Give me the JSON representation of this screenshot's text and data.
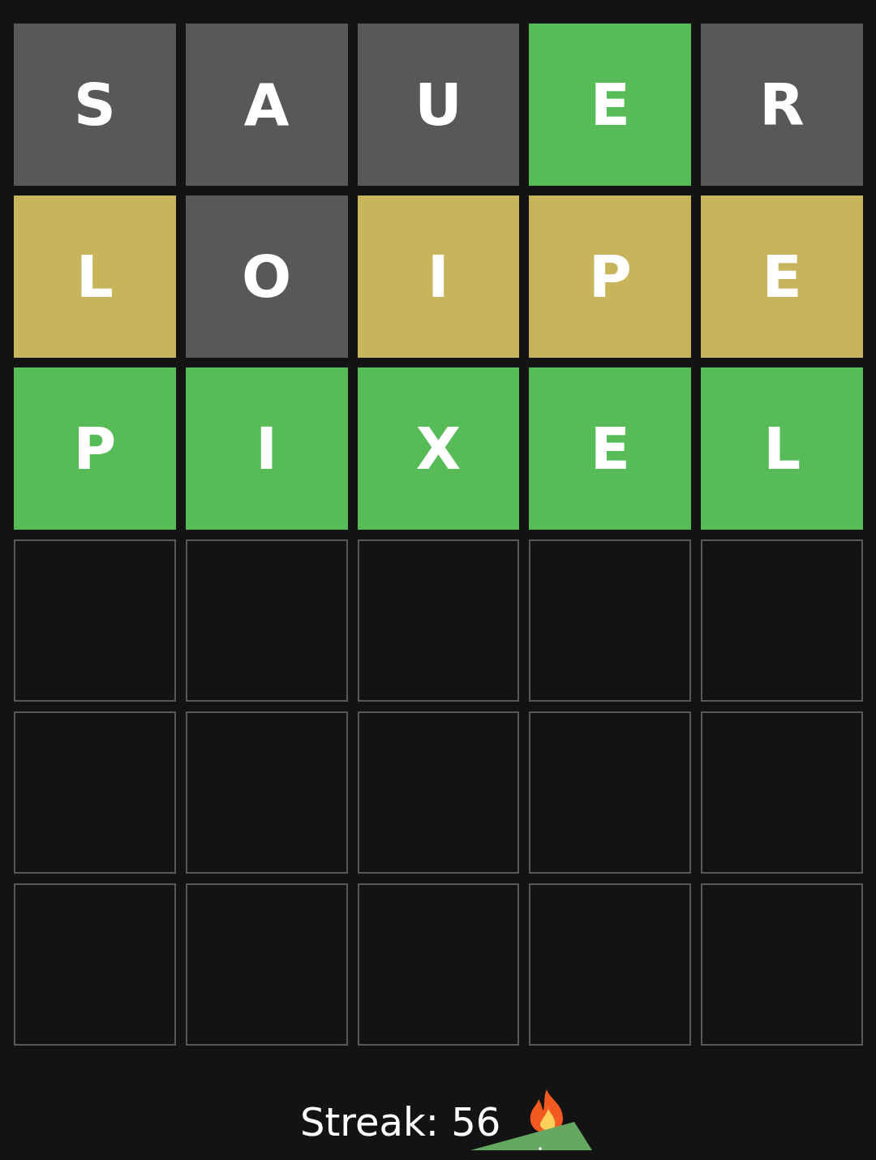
{
  "board": [
    {
      "tiles": [
        {
          "kind": "letter",
          "letter": "S",
          "color": "#585858"
        },
        {
          "kind": "letter",
          "letter": "A",
          "color": "#585858"
        },
        {
          "kind": "letter",
          "letter": "U",
          "color": "#585858"
        },
        {
          "kind": "letter",
          "letter": "E",
          "color": "#57bb58"
        },
        {
          "kind": "letter",
          "letter": "R",
          "color": "#585858"
        }
      ]
    },
    {
      "tiles": [
        {
          "kind": "letter",
          "letter": "L",
          "color": "#c8b45a"
        },
        {
          "kind": "letter",
          "letter": "O",
          "color": "#585858"
        },
        {
          "kind": "letter",
          "letter": "I",
          "color": "#c8b45a"
        },
        {
          "kind": "letter",
          "letter": "P",
          "color": "#c8b45a"
        },
        {
          "kind": "letter",
          "letter": "E",
          "color": "#c8b45a"
        }
      ]
    },
    {
      "tiles": [
        {
          "kind": "letter",
          "letter": "P",
          "color": "#57bb58"
        },
        {
          "kind": "letter",
          "letter": "I",
          "color": "#57bb58"
        },
        {
          "kind": "letter",
          "letter": "X",
          "color": "#57bb58"
        },
        {
          "kind": "letter",
          "letter": "E",
          "color": "#57bb58"
        },
        {
          "kind": "letter",
          "letter": "L",
          "color": "#57bb58"
        }
      ]
    },
    {
      "tiles": [
        {
          "kind": "empty"
        },
        {
          "kind": "empty"
        },
        {
          "kind": "empty"
        },
        {
          "kind": "empty"
        },
        {
          "kind": "empty"
        }
      ]
    },
    {
      "tiles": [
        {
          "kind": "empty"
        },
        {
          "kind": "empty"
        },
        {
          "kind": "empty"
        },
        {
          "kind": "empty"
        },
        {
          "kind": "empty"
        }
      ]
    },
    {
      "tiles": [
        {
          "kind": "empty"
        },
        {
          "kind": "empty"
        },
        {
          "kind": "empty"
        },
        {
          "kind": "empty"
        },
        {
          "kind": "empty"
        }
      ]
    }
  ],
  "streak": "Streak: 56"
}
